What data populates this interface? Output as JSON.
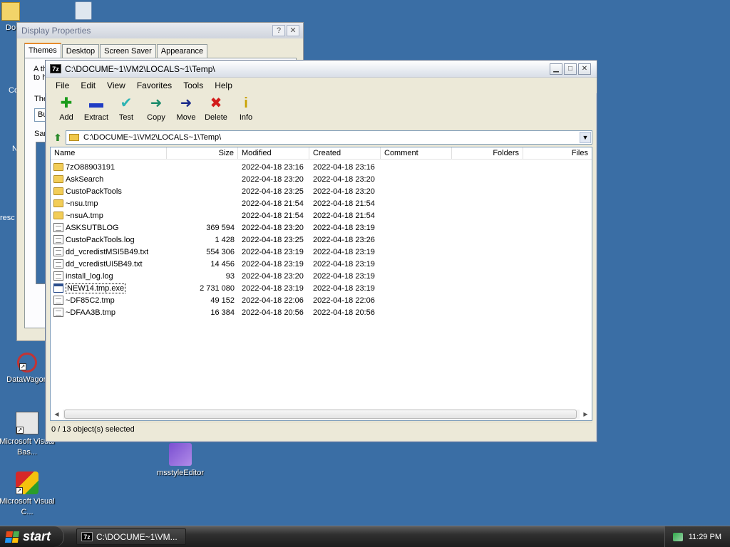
{
  "desktop": {
    "icons": [
      {
        "label": "DataWagon"
      },
      {
        "label": "Microsoft Visual Bas..."
      },
      {
        "label": "Microsoft Visual C..."
      },
      {
        "label": "msstyleEditor"
      }
    ],
    "partial_labels": [
      "Do",
      "Co",
      "N",
      "resc"
    ]
  },
  "display_properties": {
    "title": "Display Properties",
    "help_btn": "?",
    "close_btn": "✕",
    "tabs": [
      "Themes",
      "Desktop",
      "Screen Saver",
      "Appearance"
    ],
    "text_line1": "A th",
    "text_line2": "to h",
    "theme_label": "The",
    "theme_value": "Bu",
    "sample_label": "Sar"
  },
  "window": {
    "title": "C:\\DOCUME~1\\VM2\\LOCALS~1\\Temp\\",
    "app_icon": "7z",
    "menu": [
      "File",
      "Edit",
      "View",
      "Favorites",
      "Tools",
      "Help"
    ],
    "toolbar": [
      {
        "label": "Add",
        "icon": "plus-icon",
        "glyph": "✚",
        "color": "#1a9b1a"
      },
      {
        "label": "Extract",
        "icon": "minus-icon",
        "glyph": "▬",
        "color": "#1f3cc4"
      },
      {
        "label": "Test",
        "icon": "check-icon",
        "glyph": "✔",
        "color": "#2db3b3"
      },
      {
        "label": "Copy",
        "icon": "copy-arrow-icon",
        "glyph": "➜",
        "color": "#1a8a6a"
      },
      {
        "label": "Move",
        "icon": "move-arrow-icon",
        "glyph": "➜",
        "color": "#1a2a8a"
      },
      {
        "label": "Delete",
        "icon": "delete-icon",
        "glyph": "✖",
        "color": "#d21c1c"
      },
      {
        "label": "Info",
        "icon": "info-icon",
        "glyph": "i",
        "color": "#c9a200"
      }
    ],
    "address": "C:\\DOCUME~1\\VM2\\LOCALS~1\\Temp\\",
    "columns": [
      "Name",
      "Size",
      "Modified",
      "Created",
      "Comment",
      "Folders",
      "Files"
    ],
    "rows": [
      {
        "type": "folder",
        "name": "7zO88903191",
        "size": "",
        "modified": "2022-04-18 23:16",
        "created": "2022-04-18 23:16"
      },
      {
        "type": "folder",
        "name": "AskSearch",
        "size": "",
        "modified": "2022-04-18 23:20",
        "created": "2022-04-18 23:20"
      },
      {
        "type": "folder",
        "name": "CustoPackTools",
        "size": "",
        "modified": "2022-04-18 23:25",
        "created": "2022-04-18 23:20"
      },
      {
        "type": "folder",
        "name": "~nsu.tmp",
        "size": "",
        "modified": "2022-04-18 21:54",
        "created": "2022-04-18 21:54"
      },
      {
        "type": "folder",
        "name": "~nsuA.tmp",
        "size": "",
        "modified": "2022-04-18 21:54",
        "created": "2022-04-18 21:54"
      },
      {
        "type": "file",
        "name": "ASKSUTBLOG",
        "size": "369 594",
        "modified": "2022-04-18 23:20",
        "created": "2022-04-18 23:19"
      },
      {
        "type": "file",
        "name": "CustoPackTools.log",
        "size": "1 428",
        "modified": "2022-04-18 23:25",
        "created": "2022-04-18 23:26"
      },
      {
        "type": "file",
        "name": "dd_vcredistMSI5B49.txt",
        "size": "554 306",
        "modified": "2022-04-18 23:19",
        "created": "2022-04-18 23:19"
      },
      {
        "type": "file",
        "name": "dd_vcredistUI5B49.txt",
        "size": "14 456",
        "modified": "2022-04-18 23:19",
        "created": "2022-04-18 23:19"
      },
      {
        "type": "file",
        "name": "install_log.log",
        "size": "93",
        "modified": "2022-04-18 23:20",
        "created": "2022-04-18 23:19"
      },
      {
        "type": "exe",
        "name": "NEW14.tmp.exe",
        "size": "2 731 080",
        "modified": "2022-04-18 23:19",
        "created": "2022-04-18 23:19"
      },
      {
        "type": "file",
        "name": "~DF85C2.tmp",
        "size": "49 152",
        "modified": "2022-04-18 22:06",
        "created": "2022-04-18 22:06"
      },
      {
        "type": "file",
        "name": "~DFAA3B.tmp",
        "size": "16 384",
        "modified": "2022-04-18 20:56",
        "created": "2022-04-18 20:56"
      }
    ],
    "status": "0 / 13 object(s) selected"
  },
  "taskbar": {
    "start_label": "start",
    "task_label": "C:\\DOCUME~1\\VM...",
    "clock": "11:29 PM"
  }
}
